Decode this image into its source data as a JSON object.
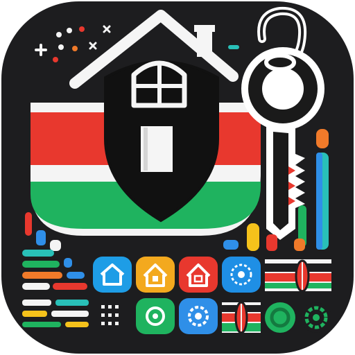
{
  "app_icon": {
    "theme": "kenya-home-security",
    "colors": {
      "background": "#1d1d1f",
      "flag_red": "#e8382e",
      "flag_green": "#1fb35f",
      "flag_white": "#f4f4f4",
      "house_stroke": "#f5f5f5",
      "shield": "#111111",
      "key_outline": "#ffffff",
      "key_fill": "#1a1a1a",
      "accent_orange": "#f07a2a",
      "accent_blue": "#2f8fe8",
      "accent_teal": "#29c0b8",
      "accent_yellow": "#f5c21b"
    },
    "tiles": [
      {
        "name": "home-tile-blue",
        "icon": "house-icon",
        "color": "#1e9de6"
      },
      {
        "name": "home-tile-yellow",
        "icon": "house-lock-icon",
        "color": "#f3a91e"
      },
      {
        "name": "home-tile-red",
        "icon": "house-shield-icon",
        "color": "#e8382e"
      },
      {
        "name": "settings-tile-blue",
        "icon": "gear-icon",
        "color": "#1f8fe5"
      },
      {
        "name": "flag-tile-1",
        "icon": "kenya-shield-icon",
        "color": "#e8382e"
      },
      {
        "name": "grid-tile",
        "icon": "dot-grid-icon",
        "color": "#1d1d1f"
      },
      {
        "name": "green-tile",
        "icon": "target-icon",
        "color": "#1fb35f"
      },
      {
        "name": "settings-tile-blue-2",
        "icon": "gear-icon",
        "color": "#2f8fe8"
      },
      {
        "name": "flag-tile-2",
        "icon": "kenya-shield-icon",
        "color": "#1fb35f"
      },
      {
        "name": "green-circle-tile",
        "icon": "ring-icon",
        "color": "#1fb35f"
      },
      {
        "name": "gear-tile-green",
        "icon": "gear-icon",
        "color": "#1fb35f"
      }
    ],
    "bars": {
      "left_colors": [
        "#f07a2a",
        "#2f8fe8",
        "#29c0b8",
        "#1fb35f",
        "#e8382e",
        "#f5c21b",
        "#f4f4f4"
      ],
      "right_colors": [
        "#f07a2a",
        "#29c0b8",
        "#2f8fe8",
        "#1fb35f",
        "#e8382e"
      ]
    }
  }
}
